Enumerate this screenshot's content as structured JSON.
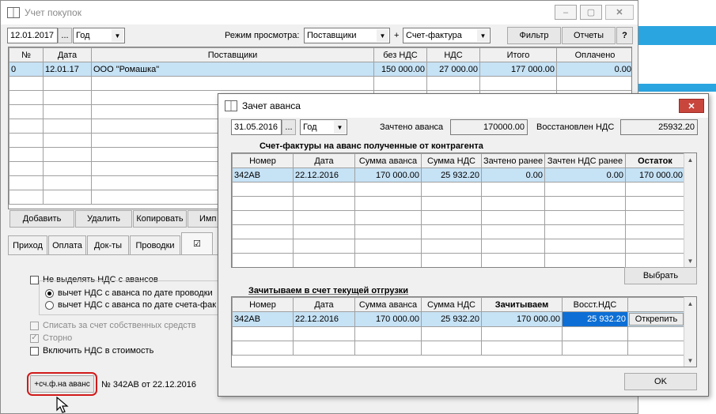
{
  "main": {
    "title": "Учет покупок",
    "date": "12.01.2017",
    "ellipsis": "...",
    "period": "Год",
    "view_mode_label": "Режим просмотра:",
    "view_mode": "Поставщики",
    "plus": "+",
    "doc_type": "Счет-фактура",
    "filter_btn": "Фильтр",
    "reports_btn": "Отчеты",
    "help_btn": "?",
    "columns": [
      "№",
      "Дата",
      "Поставщики",
      "без НДС",
      "НДС",
      "Итого",
      "Оплачено"
    ],
    "rows": [
      {
        "num": "0",
        "date": "12.01.17",
        "supplier": "ООО \"Ромашка\"",
        "net": "150 000.00",
        "vat": "27 000.00",
        "total": "177 000.00",
        "paid": "0.00"
      }
    ],
    "actions": {
      "add": "Добавить",
      "delete": "Удалить",
      "copy": "Копировать",
      "import": "Имп"
    },
    "tabs": [
      "Приход",
      "Оплата",
      "Док-ты",
      "Проводки",
      "☑"
    ],
    "opt_no_vat": "Не выделять НДС с авансов",
    "radio1": "вычет НДС с аванса по дате проводки",
    "radio2": "вычет НДС с аванса по дате счета-фак",
    "chk_own": "Списать за счет собственных средств",
    "chk_storno": "Сторно",
    "chk_include": "Включить НДС в стоимость",
    "advance_btn": "+сч.ф.на аванс",
    "invoice_info": "№ 342АВ от 22.12.2016"
  },
  "dialog": {
    "title": "Зачет аванса",
    "date": "31.05.2016",
    "ellipsis": "...",
    "period": "Год",
    "offset_label": "Зачтено аванса",
    "offset_value": "170000.00",
    "restored_label": "Восстановлен НДС",
    "restored_value": "25932.20",
    "received_title": "Счет-фактуры на аванс полученные от контрагента",
    "received_columns": [
      "Номер",
      "Дата",
      "Сумма аванса",
      "Сумма НДС",
      "Зачтено ранее",
      "Зачтен НДС ранее",
      "Остаток"
    ],
    "received_rows": [
      {
        "num": "342АВ",
        "date": "22.12.2016",
        "amount": "170 000.00",
        "vat": "25 932.20",
        "offset_before": "0.00",
        "vat_before": "0.00",
        "rest": "170 000.00"
      }
    ],
    "select_btn": "Выбрать",
    "current_title": "Зачитываем в счет текущей отгрузки",
    "current_columns": [
      "Номер",
      "Дата",
      "Сумма аванса",
      "Сумма НДС",
      "Зачитываем",
      "Восст.НДС",
      ""
    ],
    "current_rows": [
      {
        "num": "342АВ",
        "date": "22.12.2016",
        "amount": "170 000.00",
        "vat": "25 932.20",
        "offset": "170 000.00",
        "restore_vat": "25 932.20",
        "detach": "Открепить"
      }
    ],
    "ok_btn": "OK"
  },
  "colors": {
    "highlight_row": "#c6e2f5",
    "edit_cell": "#0d6fd5",
    "annotation": "#d11a1a",
    "background_accent": "#2ba5e0"
  },
  "icons": [
    "app-book-icon",
    "minimize-icon",
    "maximize-icon",
    "close-icon",
    "dropdown-arrow-icon",
    "mouse-cursor-icon"
  ]
}
